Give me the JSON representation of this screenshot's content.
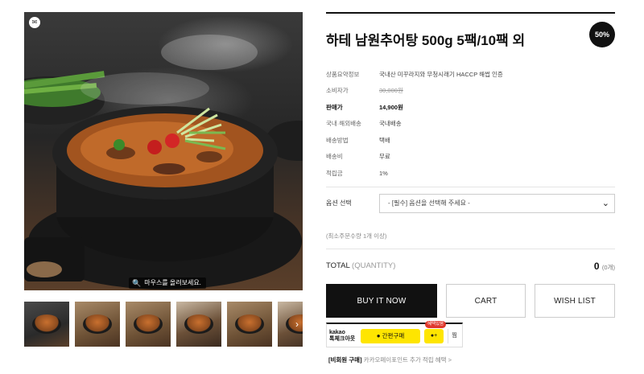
{
  "gallery": {
    "corner_badge_icon": "chat-bubble-icon",
    "zoom_hint": "마우스를 올려보세요.",
    "thumbnail_next_icon": "chevron-right-icon",
    "thumbnail_count": 6
  },
  "product": {
    "title": "하테 남원추어탕 500g 5팩/10팩 외",
    "discount_badge": "50%",
    "specs": [
      {
        "key": "상품요약정보",
        "value": "국내산 미꾸라지와 무청시래기 HACCP 해썹 인증"
      },
      {
        "key": "소비자가",
        "value": "30,000원"
      },
      {
        "key": "판매가",
        "value": "14,900원"
      },
      {
        "key": "국내·해외배송",
        "value": "국내배송"
      },
      {
        "key": "배송방법",
        "value": "택배"
      },
      {
        "key": "배송비",
        "value": "무료"
      },
      {
        "key": "적립금",
        "value": "1%"
      }
    ]
  },
  "options": {
    "label": "옵션 선택",
    "select_value": "- [필수] 옵션을 선택해 주세요 -",
    "min_qty_note": "(최소주문수량 1개 이상)"
  },
  "total": {
    "label": "TOTAL",
    "qualifier": "(QUANTITY)",
    "amount": "0",
    "unit": "(0개)"
  },
  "actions": {
    "buy_label": "BUY IT NOW",
    "cart_label": "CART",
    "wish_label": "WISH LIST"
  },
  "kakao": {
    "brand_line1": "kakao",
    "brand_line2": "톡체크아웃",
    "pay_label": "간편구매",
    "promo_tag": "혜택있음",
    "mini_label": "+",
    "web_label": "찜",
    "note_bold": "[비회원 구매]",
    "note_text": " 카카오페이포인트 추가 적립 혜택 >"
  },
  "colors": {
    "primary_button": "#111111",
    "kakao_yellow": "#fee500",
    "promo_red": "#e0392d"
  }
}
